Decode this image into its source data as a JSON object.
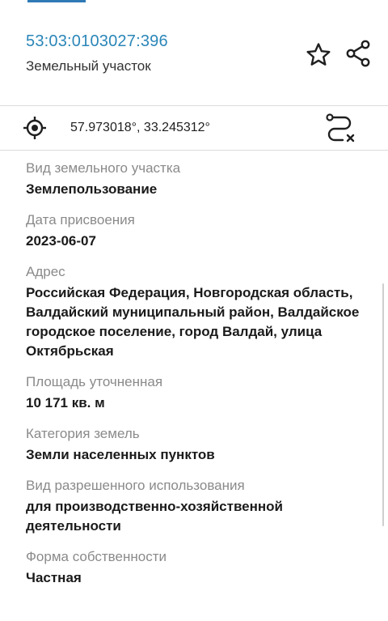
{
  "header": {
    "cadastral_number": "53:03:0103027:396",
    "object_type": "Земельный участок"
  },
  "coords": {
    "text": "57.973018°, 33.245312°"
  },
  "fields": [
    {
      "label": "Вид земельного участка",
      "value": "Землепользование"
    },
    {
      "label": "Дата присвоения",
      "value": "2023-06-07"
    },
    {
      "label": "Адрес",
      "value": "Российская Федерация, Новгородская область, Валдайский муниципальный район, Валдайское городское поселение, город Валдай, улица Октябрьская"
    },
    {
      "label": "Площадь уточненная",
      "value": "10 171 кв. м"
    },
    {
      "label": "Категория земель",
      "value": "Земли населенных пунктов"
    },
    {
      "label": "Вид разрешенного использования",
      "value": "для производственно-хозяйственной деятельности"
    },
    {
      "label": "Форма собственности",
      "value": "Частная"
    }
  ],
  "colors": {
    "accent": "#2a86b8",
    "label": "#8a8a8a",
    "value": "#1a1a1a"
  },
  "icons": {
    "favorite": "star-icon",
    "share": "share-icon",
    "locate": "crosshair-icon",
    "route": "route-icon"
  }
}
